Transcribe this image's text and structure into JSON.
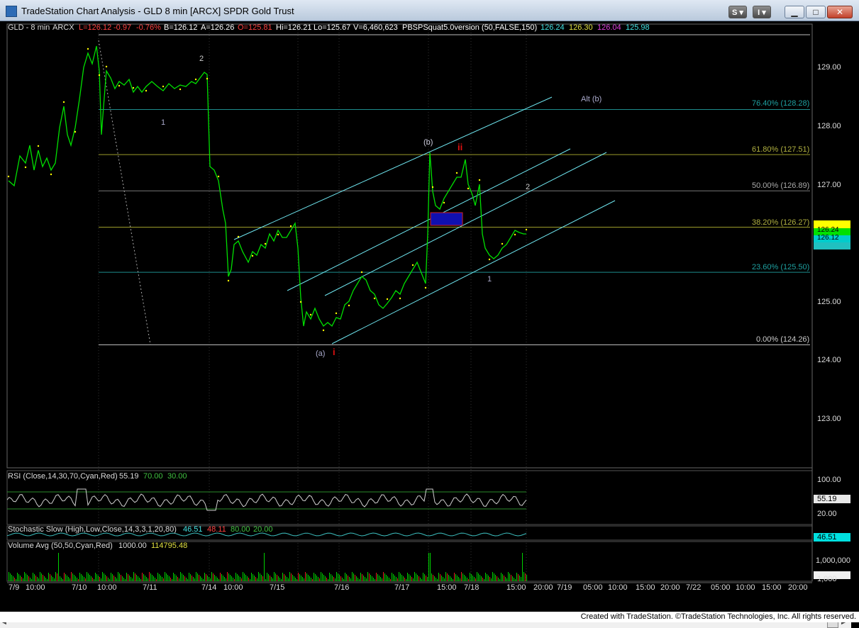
{
  "window": {
    "title": "TradeStation Chart Analysis - GLD 8 min [ARCX] SPDR Gold Trust",
    "s_button": "S",
    "i_button": "I",
    "min_glyph": "▁",
    "max_glyph": "□",
    "close_glyph": "✕"
  },
  "colors": {
    "price": "#00e000",
    "channel": "#6fe6f0",
    "fib_olive": "#9a9a2a",
    "fib_teal": "#1e8c8c",
    "label_red": "#e01010",
    "rsi_line": "#d0d0d0"
  },
  "header": {
    "symbol": "GLD - 8 min",
    "exchange": "ARCX",
    "last": "L=126.12",
    "change": "-0.97",
    "change_pct": "-0.76%",
    "bid": "B=126.12",
    "ask": "A=126.26",
    "open": "O=125.81",
    "high": "Hi=126.21",
    "low": "Lo=125.67",
    "volume": "V=6,460,623",
    "indicator": "PBSPSquat5.0version (50,FALSE,150)",
    "ind_v1": "126.24",
    "ind_v2": "126.30",
    "ind_v3": "126.04",
    "ind_v4": "125.98"
  },
  "fib_levels": [
    {
      "label": "76.40% (128.28)",
      "price": 128.28,
      "color": "#1e8c8c"
    },
    {
      "label": "61.80% (127.51)",
      "price": 127.51,
      "color": "#9a9a2a"
    },
    {
      "label": "50.00% (126.89)",
      "price": 126.89,
      "color": "#777777"
    },
    {
      "label": "38.20% (126.27)",
      "price": 126.27,
      "color": "#9a9a2a"
    },
    {
      "label": "23.60% (125.50)",
      "price": 125.5,
      "color": "#1e8c8c"
    },
    {
      "label": "0.00% (124.26)",
      "price": 124.26,
      "color": "#bbbbbb"
    }
  ],
  "price_axis": [
    "129.00",
    "128.00",
    "127.00",
    "125.00",
    "124.00",
    "123.00"
  ],
  "right_tags": [
    "126.24",
    "126.12"
  ],
  "wave_labels": {
    "two_top": "2",
    "one_top": "1",
    "alt_b": "Alt (b)",
    "b_label": "(b)",
    "ii_label": "ii",
    "two_right": "2",
    "a_label": "(a)",
    "i_label": "i",
    "one_right": "1"
  },
  "rsi": {
    "label": "RSI (Close,14,30,70,Cyan,Red)",
    "value": "55.19",
    "ob": "70.00",
    "os": "30.00",
    "axis_top": "100.00",
    "axis_bottom": "20.00",
    "tag": "55.19"
  },
  "stoch": {
    "label": "Stochastic Slow (High,Low,Close,14,3,3,1,20,80)",
    "k": "46.51",
    "d": "48.11",
    "ob": "80.00",
    "os": "20.00",
    "tag": "46.51"
  },
  "volume": {
    "label": "Volume Avg (50,50,Cyan,Red)",
    "v1": "1000.00",
    "v2": "114795.48",
    "axis_top": "1,000,000",
    "axis_bottom": "1,000"
  },
  "time_axis": [
    "7/9",
    "10:00",
    "7/10",
    "10:00",
    "7/11",
    "7/14",
    "10:00",
    "7/15",
    "7/16",
    "7/17",
    "15:00",
    "7/18",
    "15:00",
    "20:00",
    "7/19",
    "05:00",
    "10:00",
    "15:00",
    "20:00",
    "7/22",
    "05:00",
    "10:00",
    "15:00",
    "20:00"
  ],
  "footer": "Created with TradeStation. ©TradeStation Technologies, Inc. All rights reserved."
}
